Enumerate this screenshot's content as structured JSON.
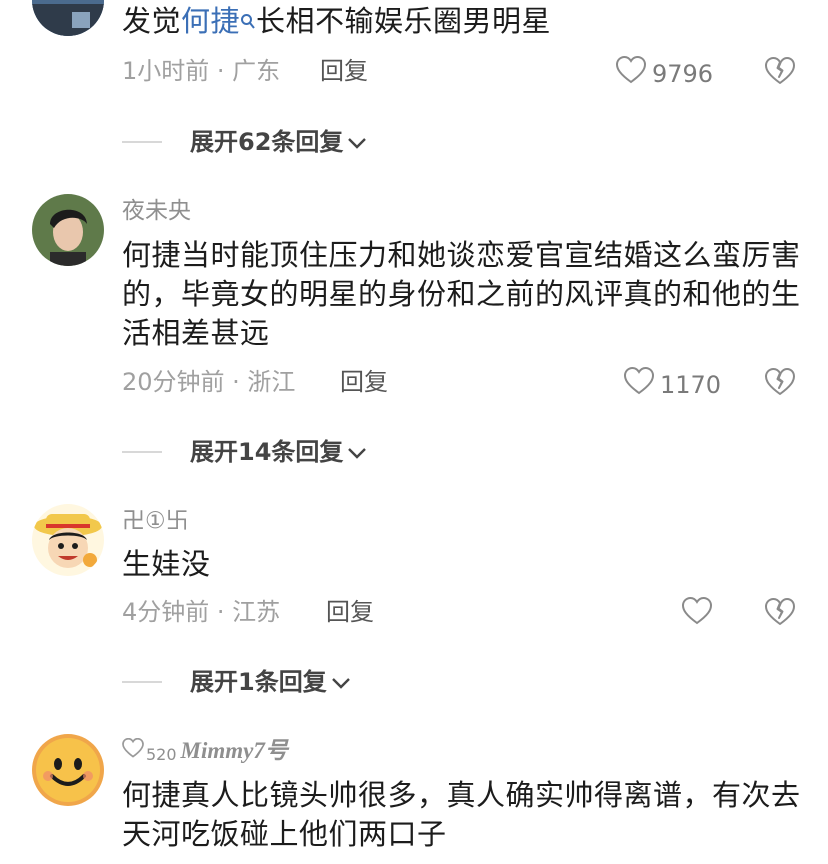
{
  "comments": [
    {
      "username": "",
      "text_prefix": "发觉",
      "text_link": "何捷",
      "text_suffix": "长相不输娱乐圈男明星",
      "time_location": "1小时前 · 广东",
      "reply_label": "回复",
      "likes": "9796",
      "expand_label": "展开62条回复"
    },
    {
      "username": "夜未央",
      "text": "何捷当时能顶住压力和她谈恋爱官宣结婚这么蛮厉害的，毕竟女的明星的身份和之前的风评真的和他的生活相差甚远",
      "time_location": "20分钟前 · 浙江",
      "reply_label": "回复",
      "likes": "1170",
      "expand_label": "展开14条回复"
    },
    {
      "username": "卍①卐",
      "text": "生娃没",
      "time_location": "4分钟前 · 江苏",
      "reply_label": "回复",
      "likes": "",
      "expand_label": "展开1条回复"
    },
    {
      "username_small": "520",
      "username_main": "Mimmy7号",
      "text": "何捷真人比镜头帅很多，真人确实帅得离谱，有次去天河吃饭碰上他们两口子"
    }
  ],
  "icons": {
    "like": "heart-outline-icon",
    "dislike": "broken-heart-icon",
    "search": "search-icon",
    "expand": "chevron-down-icon"
  },
  "colors": {
    "link": "#3b6fb6",
    "meta": "#a0a0a0"
  }
}
